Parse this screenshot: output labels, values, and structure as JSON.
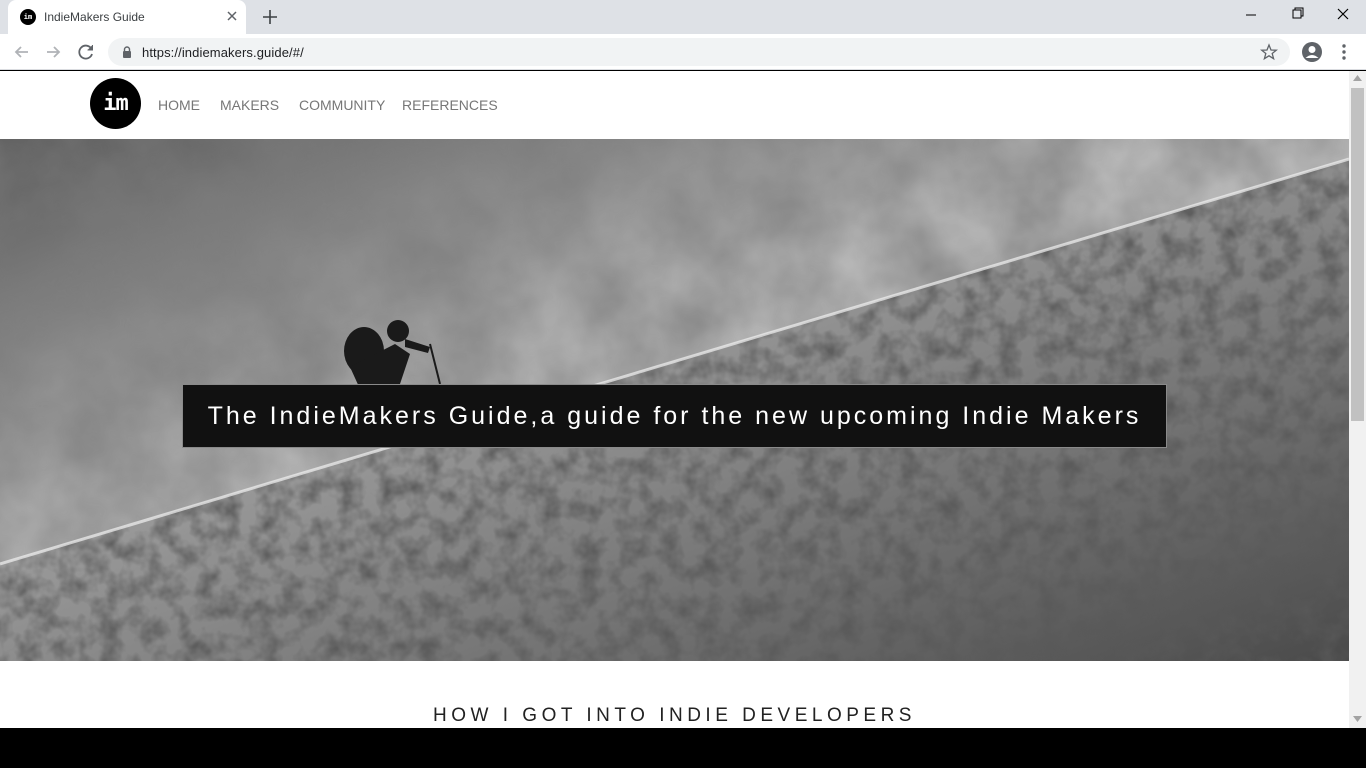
{
  "browser": {
    "tab_title": "IndieMakers Guide",
    "favicon_text": "im",
    "url": "https://indiemakers.guide/#/"
  },
  "site": {
    "logo_text": "im",
    "nav": [
      "HOME",
      "MAKERS",
      "COMMUNITY",
      "REFERENCES"
    ]
  },
  "hero": {
    "caption": "The IndieMakers Guide,a guide for the new upcoming Indie Makers"
  },
  "section": {
    "title": "HOW I GOT INTO INDIE DEVELOPERS"
  },
  "colors": {
    "tabbar_bg": "#dee1e6",
    "nav_text": "#777777",
    "caption_bg": "#111111"
  },
  "icons": [
    "close-icon",
    "plus-icon",
    "minimize-icon",
    "maximize-icon",
    "back-arrow-icon",
    "forward-arrow-icon",
    "reload-icon",
    "lock-icon",
    "star-icon",
    "account-icon",
    "more-vert-icon"
  ]
}
